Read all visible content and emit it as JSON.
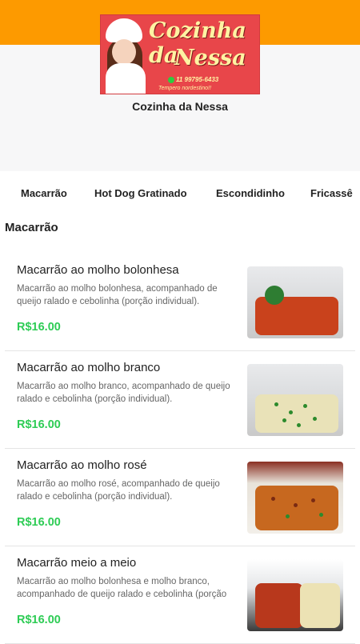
{
  "store": {
    "logo": {
      "title_line1": "Cozinha da",
      "title_line2": "Nessa",
      "phone": "11 99795-6433",
      "tagline": "Tempero nordestino!!"
    },
    "name": "Cozinha da Nessa"
  },
  "tabs": [
    {
      "label": "Macarrão"
    },
    {
      "label": "Hot Dog Gratinado"
    },
    {
      "label": "Escondidinho"
    },
    {
      "label": "Fricassê"
    }
  ],
  "section": {
    "title": "Macarrão",
    "items": [
      {
        "name": "Macarrão ao molho bolonhesa",
        "description": "Macarrão ao molho bolonhesa, acompanhado de queijo ralado e cebolinha (porção individual).",
        "price": "R$16.00",
        "image_icon": "pasta-bolognese-photo",
        "food_color": "#c9421c"
      },
      {
        "name": "Macarrão ao molho branco",
        "description": "Macarrão ao molho branco, acompanhado de queijo ralado e cebolinha (porção individual).",
        "price": "R$16.00",
        "image_icon": "pasta-white-sauce-photo",
        "food_color": "#e9e2b8"
      },
      {
        "name": "Macarrão ao molho rosé",
        "description": "Macarrão ao molho rosé, acompanhado de queijo ralado e cebolinha (porção individual).",
        "price": "R$16.00",
        "image_icon": "pasta-rose-sauce-photo",
        "food_color": "#c7681f"
      },
      {
        "name": "Macarrão meio a meio",
        "description": "Macarrão ao molho bolonhesa e molho branco, acompanhado de queijo ralado e cebolinha (porção individual).",
        "price": "R$16.00",
        "image_icon": "pasta-half-half-photo",
        "food_color": "#b8381c"
      }
    ]
  },
  "colors": {
    "accent": "#fd9a00",
    "price": "#2ecc55"
  }
}
